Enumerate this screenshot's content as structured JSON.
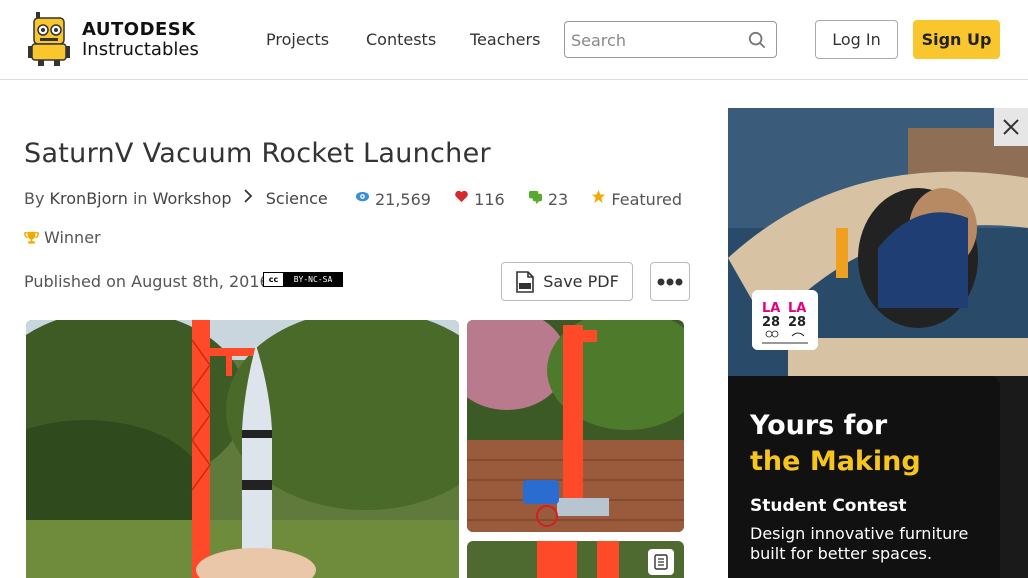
{
  "header": {
    "logo_line1": "AUTODESK",
    "logo_line2": "Instructables",
    "nav": {
      "projects": "Projects",
      "contests": "Contests",
      "teachers": "Teachers"
    },
    "search_placeholder": "Search",
    "login_label": "Log In",
    "signup_label": "Sign Up"
  },
  "article": {
    "title": "SaturnV Vacuum Rocket Launcher",
    "by_label": "By",
    "author": "KronBjorn",
    "in_label": "in",
    "category": "Workshop",
    "subcategory": "Science",
    "views": "21,569",
    "favorites": "116",
    "comments": "23",
    "featured_label": "Featured",
    "winner_label": "Winner",
    "published": "Published on August 8th, 2016",
    "license_cc": "cc",
    "license_terms": "BY-NC-SA",
    "save_pdf_label": "Save PDF"
  },
  "ad": {
    "logo_line1": "LA 28",
    "logo_line2": "OFFICIAL SUPPORTER",
    "headline_line1": "Yours for",
    "headline_line2": "the Making",
    "subtitle": "Student Contest",
    "body": "Design innovative furniture built for better spaces."
  },
  "colors": {
    "accent": "#fac62d",
    "views_icon": "#3a8fd6",
    "favorite_icon": "#d12b2b",
    "comments_icon": "#58a92f",
    "featured_icon": "#f2a900",
    "ad_highlight": "#f7c51c"
  },
  "icons": {
    "search": "search-icon",
    "views": "eye-icon",
    "favorites": "heart-icon",
    "comments": "comment-icon",
    "featured": "star-icon",
    "winner": "trophy-icon",
    "pdf": "pdf-icon",
    "more": "ellipsis-icon",
    "close": "close-icon",
    "gallery": "gallery-icon"
  }
}
